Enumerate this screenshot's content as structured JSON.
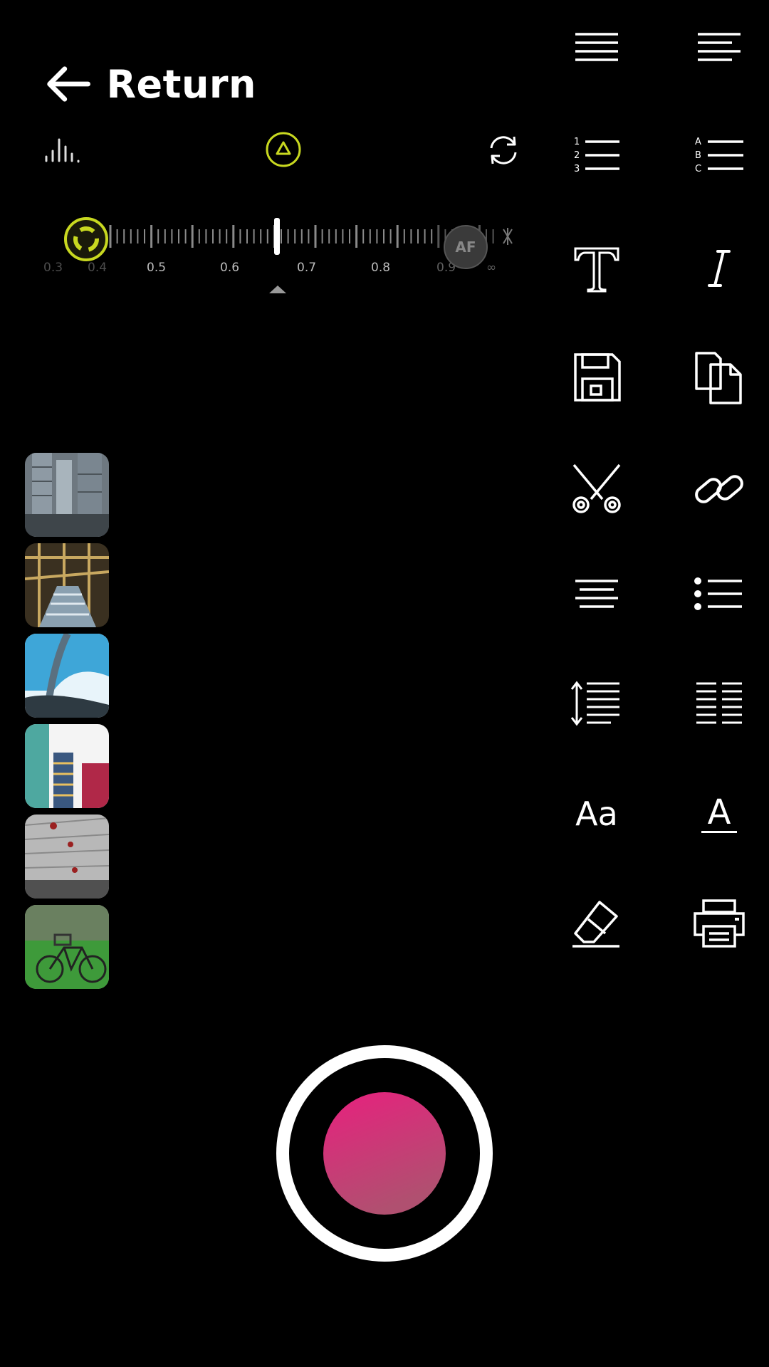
{
  "header": {
    "return_label": "Return"
  },
  "top_controls": {
    "levels_icon": "levels-icon",
    "mode_icon": "triangle-mode-icon",
    "flip_icon": "flip-camera-icon"
  },
  "zoom_scale": {
    "labels": [
      "0.3",
      "0.4",
      "0.5",
      "0.6",
      "0.7",
      "0.8",
      "0.9",
      "∞"
    ],
    "af_label": "AF",
    "accent_color": "#c8d820"
  },
  "gallery": {
    "thumbnails": [
      "building-photo",
      "scaffold-photo",
      "glass-arch-photo",
      "storefront-photo",
      "facade-photo",
      "bicycle-photo"
    ]
  },
  "toolbar": {
    "icons": [
      "align-justify-icon",
      "align-left-icon",
      "numbered-list-icon",
      "lettered-list-icon",
      "text-icon",
      "italic-icon",
      "save-icon",
      "copy-icon",
      "cut-icon",
      "link-icon",
      "align-center-icon",
      "bullet-list-icon",
      "line-spacing-icon",
      "columns-icon",
      "font-size-icon",
      "text-color-icon",
      "eraser-icon",
      "print-icon"
    ],
    "font_size_label": "Aa",
    "text_color_label": "A"
  },
  "shutter": {
    "outer_color": "#ffffff",
    "inner_color_top": "#e8207e",
    "inner_color_bottom": "#b05070"
  }
}
